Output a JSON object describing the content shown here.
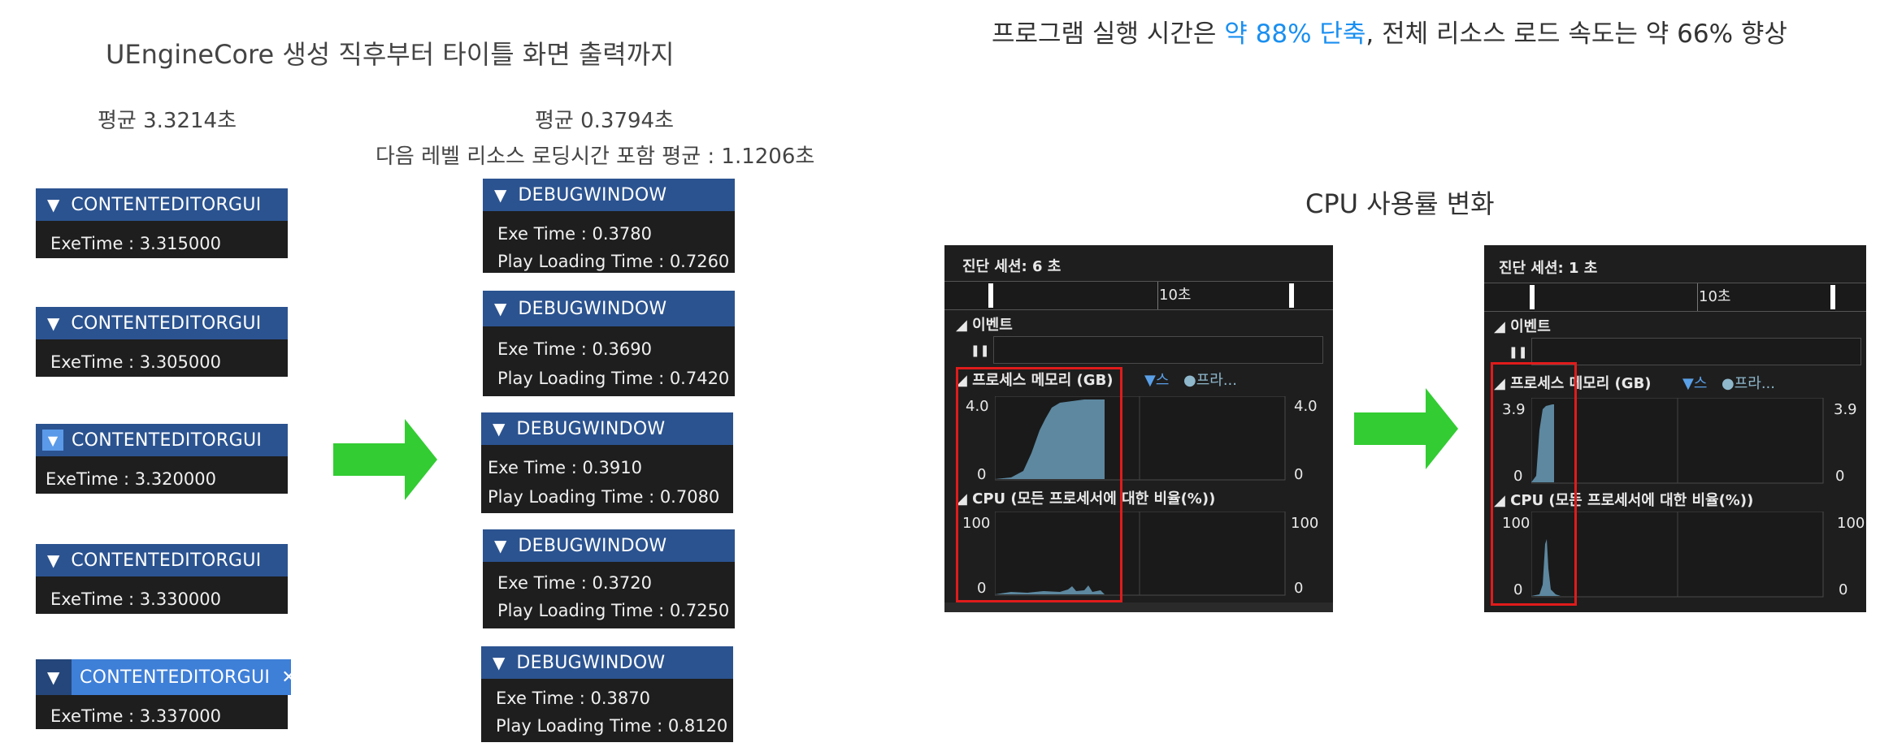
{
  "left": {
    "title": "UEngineCore 생성 직후부터 타이틀 화면 출력까지",
    "before_avg": "평균 3.3214초",
    "after_avg": "평균 0.3794초",
    "after_note": "다음 레벨 리소스 로딩시간 포함  평균 : 1.1206초",
    "before_windows": [
      {
        "title": "CONTENTEDITORGUI",
        "line1": "ExeTime : 3.315000"
      },
      {
        "title": "CONTENTEDITORGUI",
        "line1": "ExeTime : 3.305000"
      },
      {
        "title": "CONTENTEDITORGUI",
        "line1": "ExeTime : 3.320000"
      },
      {
        "title": "CONTENTEDITORGUI",
        "line1": "ExeTime : 3.330000"
      },
      {
        "title": "CONTENTEDITORGUI",
        "line1": "ExeTime : 3.337000"
      }
    ],
    "close_glyph": "✕",
    "after_windows": [
      {
        "title": "DEBUGWINDOW",
        "line1": "Exe Time : 0.3780",
        "line2": "Play Loading Time : 0.7260"
      },
      {
        "title": "DEBUGWINDOW",
        "line1": "Exe Time : 0.3690",
        "line2": "Play Loading Time : 0.7420"
      },
      {
        "title": "DEBUGWINDOW",
        "line1": "Exe Time : 0.3910",
        "line2": "Play Loading Time : 0.7080"
      },
      {
        "title": "DEBUGWINDOW",
        "line1": "Exe Time : 0.3720",
        "line2": "Play Loading Time : 0.7250"
      },
      {
        "title": "DEBUGWINDOW",
        "line1": "Exe Time : 0.3870",
        "line2": "Play Loading Time : 0.8120"
      }
    ]
  },
  "right": {
    "headline_pre": "프로그램 실행 시간은 ",
    "headline_hl": "약 88% 단축",
    "headline_post": ", 전체 리소스 로드 속도는 약 66% 향상",
    "cpu_title": "CPU 사용률 변화",
    "panels": [
      {
        "session": "진단 세션: 6 초",
        "ruler": "10초",
        "events": "◢ 이벤트",
        "pause": "❚❚",
        "mem_label": "◢ 프로세스 메모리 (GB)",
        "legend_a": "▼스",
        "legend_b": "●프라...",
        "mem_max": "4.0",
        "mem_min": "0",
        "mem_max_r": "4.0",
        "mem_min_r": "0",
        "cpu_label": "◢ CPU (모든 프로세서에 대한 비율(%))",
        "cpu_max": "100",
        "cpu_min": "0",
        "cpu_max_r": "100",
        "cpu_min_r": "0"
      },
      {
        "session": "진단 세션: 1 초",
        "ruler": "10초",
        "events": "◢ 이벤트",
        "pause": "❚❚",
        "mem_label": "◢ 프로세스 메모리 (GB)",
        "legend_a": "▼스",
        "legend_b": "●프라...",
        "mem_max": "3.9",
        "mem_min": "0",
        "mem_max_r": "3.9",
        "mem_min_r": "0",
        "cpu_label": "◢ CPU (모든 프로세서에 대한 비율(%))",
        "cpu_max": "100",
        "cpu_min": "0",
        "cpu_max_r": "100",
        "cpu_min_r": "0"
      }
    ]
  },
  "colors": {
    "arrow": "#33cc33",
    "accent": "#1a8ff0",
    "titlebar": "#2b5390",
    "frame": "#e01b1b"
  }
}
